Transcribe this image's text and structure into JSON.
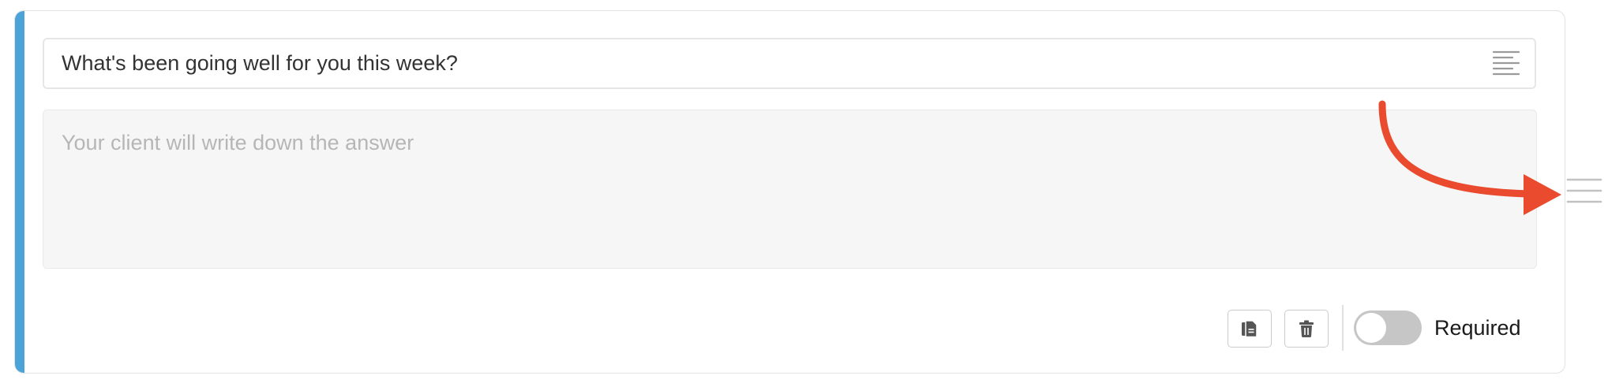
{
  "question": {
    "value": "What's been going well for you this week?",
    "format_icon": "text-lines-icon"
  },
  "answer": {
    "placeholder": "Your client will write down the answer"
  },
  "footer": {
    "copy_icon": "copy-icon",
    "delete_icon": "trash-icon",
    "required_label": "Required",
    "required_on": false
  },
  "side": {
    "drag_handle_icon": "drag-handle-icon"
  },
  "colors": {
    "accent": "#4ba3d8",
    "annotation": "#ea4a2d",
    "toggle_off": "#c6c6c6"
  }
}
